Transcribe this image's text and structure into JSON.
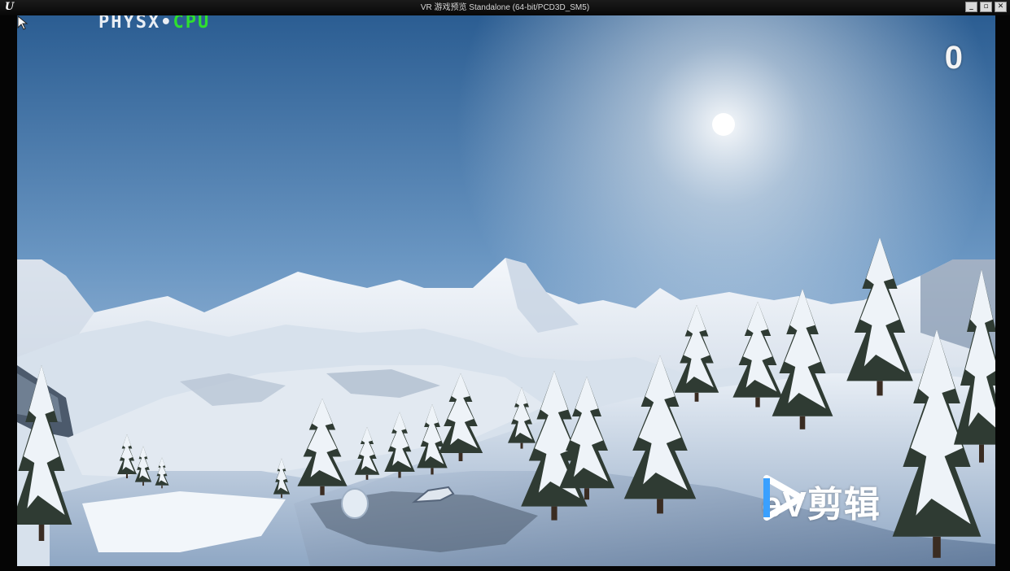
{
  "window": {
    "title": "VR 游戏预览 Standalone (64-bit/PCD3D_SM5)",
    "app_icon": "unreal-engine-logo",
    "buttons": [
      "minimize",
      "restore",
      "close"
    ]
  },
  "hud": {
    "physx_label": "PHYSX",
    "separator": "•",
    "mode_label": "CPU",
    "mode_color": "#2ee02e",
    "score": "0"
  },
  "scene": {
    "description_icons": [
      "sun",
      "snow-mountains",
      "pine-trees",
      "snowball",
      "vehicle"
    ]
  },
  "watermark": {
    "icon": "play-icon",
    "text": "eV剪辑"
  }
}
